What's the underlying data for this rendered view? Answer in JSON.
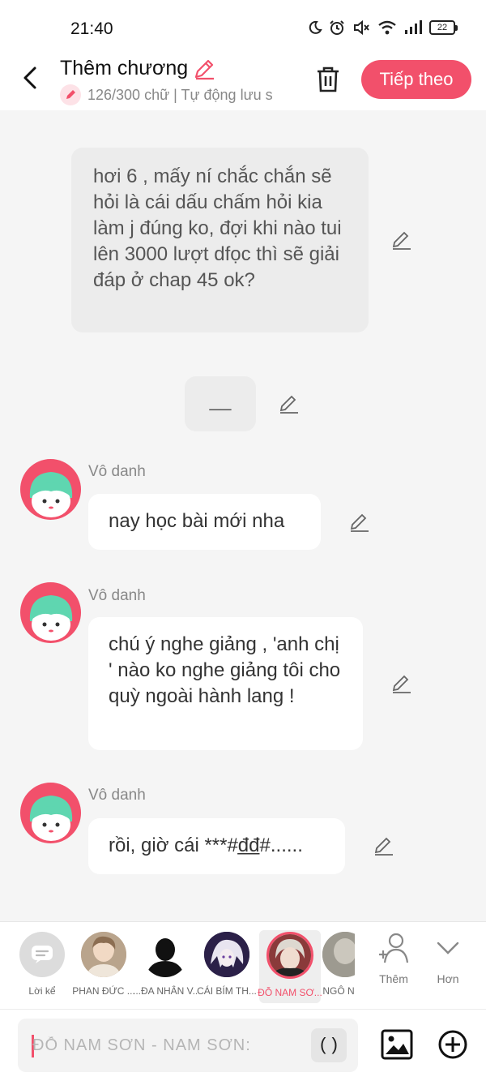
{
  "status_bar": {
    "time": "21:40",
    "battery": "22"
  },
  "header": {
    "title": "Thêm chương",
    "subtitle": "126/300 chữ | Tự động lưu s",
    "next_label": "Tiếp theo"
  },
  "messages": {
    "narration_1": "hơi 6 , mấy ní chắc chắn sẽ hỏi là cái dấu chấm hỏi kia làm j đúng ko, đợi khi nào tui lên 3000 lượt dfọc thì sẽ giải đáp ở chap 45 ok?",
    "narration_2": "__",
    "chat_1": {
      "speaker": "Vô danh",
      "text": "nay học bài mới nha"
    },
    "chat_2": {
      "speaker": "Vô danh",
      "text": "chú ý nghe giảng , 'anh chị ' nào ko nghe giảng tôi cho quỳ ngoài hành lang !"
    },
    "chat_3": {
      "speaker": "Vô danh",
      "text": "rồi, giờ cái ***#đ̲đ̲#......"
    }
  },
  "characters": [
    {
      "label": "Lời kể",
      "icon": "narrator-icon"
    },
    {
      "label": "PHAN ĐỨC ..."
    },
    {
      "label": "...ĐA NHÂN V..."
    },
    {
      "label": "CÁI BÍM TH..."
    },
    {
      "label": "ĐỖ NAM SƠ...",
      "selected": true
    },
    {
      "label": "NGÔ N"
    }
  ],
  "actions": {
    "add_label": "Thêm",
    "more_label": "Hơn"
  },
  "input": {
    "placeholder": "ĐỖ NAM SƠN - NAM SƠN:",
    "paren": "()"
  },
  "colors": {
    "accent": "#f2506b",
    "avatar_bg": "#f2506b",
    "hair": "#5fd6b0"
  }
}
